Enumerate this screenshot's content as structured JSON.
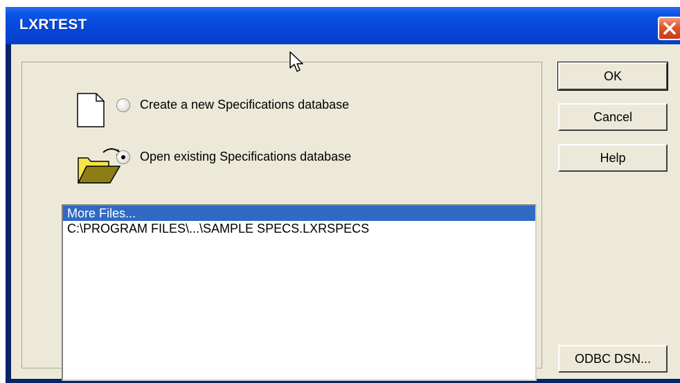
{
  "window": {
    "title": "LXRTEST"
  },
  "options": {
    "create_label": "Create a new Specifications database",
    "open_label": "Open existing Specifications database",
    "selected": "open"
  },
  "file_list": {
    "items": [
      "More Files...",
      "C:\\PROGRAM FILES\\...\\SAMPLE SPECS.LXRSPECS"
    ],
    "selected_index": 0
  },
  "buttons": {
    "ok": "OK",
    "cancel": "Cancel",
    "help": "Help",
    "odbc": "ODBC DSN..."
  },
  "icons": {
    "new_doc": "document-icon",
    "open_folder": "open-folder-icon",
    "close": "close-icon",
    "cursor": "mouse-cursor-icon"
  },
  "colors": {
    "titlebar": "#0646D8",
    "dialog_bg": "#ECE9D8",
    "selection": "#316AC5",
    "close_button": "#E0542C"
  }
}
